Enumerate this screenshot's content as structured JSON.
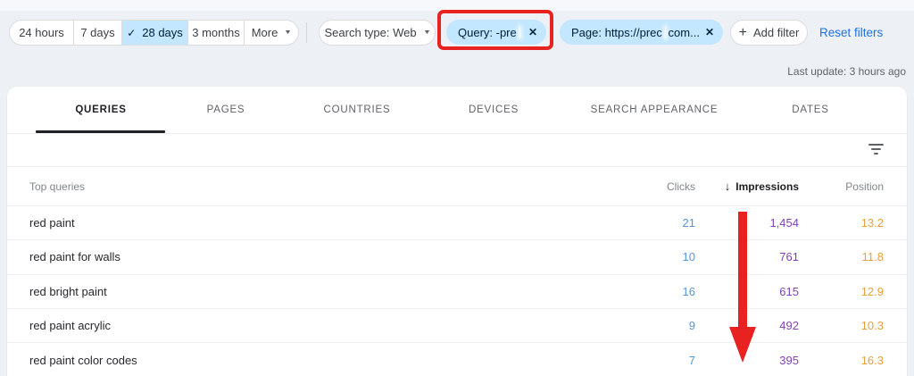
{
  "toolbar": {
    "date_ranges": [
      {
        "label": "24 hours",
        "selected": false
      },
      {
        "label": "7 days",
        "selected": false
      },
      {
        "label": "28 days",
        "selected": true
      },
      {
        "label": "3 months",
        "selected": false
      }
    ],
    "more": {
      "label": "More"
    },
    "search_type_chip": {
      "label": "Search type: Web"
    },
    "query_chip": {
      "label": "Query: -pre",
      "redacted": true
    },
    "page_chip": {
      "label_prefix": "Page: https://prec",
      "label_suffix": "com...",
      "redacted": true
    },
    "add_filter": {
      "label": "Add filter"
    },
    "reset_filters": {
      "label": "Reset filters"
    }
  },
  "status": {
    "last_update": "Last update: 3 hours ago"
  },
  "tabs": [
    {
      "label": "QUERIES",
      "active": true
    },
    {
      "label": "PAGES",
      "active": false
    },
    {
      "label": "COUNTRIES",
      "active": false
    },
    {
      "label": "DEVICES",
      "active": false
    },
    {
      "label": "SEARCH APPEARANCE",
      "active": false
    },
    {
      "label": "DATES",
      "active": false
    }
  ],
  "table": {
    "row_header": "Top queries",
    "columns": {
      "clicks": "Clicks",
      "impressions": "Impressions",
      "position": "Position"
    },
    "sort": {
      "column": "Impressions",
      "direction": "desc"
    },
    "rows": [
      {
        "query": "red paint",
        "clicks": "21",
        "impressions": "1,454",
        "position": "13.2"
      },
      {
        "query": "red paint for walls",
        "clicks": "10",
        "impressions": "761",
        "position": "11.8"
      },
      {
        "query": "red bright paint",
        "clicks": "16",
        "impressions": "615",
        "position": "12.9"
      },
      {
        "query": "red paint acrylic",
        "clicks": "9",
        "impressions": "492",
        "position": "10.3"
      },
      {
        "query": "red paint color codes",
        "clicks": "7",
        "impressions": "395",
        "position": "16.3"
      }
    ]
  },
  "icons": {
    "check": "✓",
    "dropdown": "▼",
    "close": "✕",
    "plus": "+",
    "sort_desc": "↓"
  },
  "colors": {
    "selected_chip_bg": "#c2e7ff",
    "link_blue": "#1a73e8",
    "clicks_value": "#5596d8",
    "impressions_value": "#8143b4",
    "position_value": "#e6a13d",
    "annotation_red": "#e82121"
  },
  "annotations": {
    "highlight_box": {
      "target": "query-filter-chip",
      "color": "#e82121"
    },
    "arrow": {
      "target": "impressions-column",
      "direction": "down",
      "color": "#e82121"
    }
  }
}
